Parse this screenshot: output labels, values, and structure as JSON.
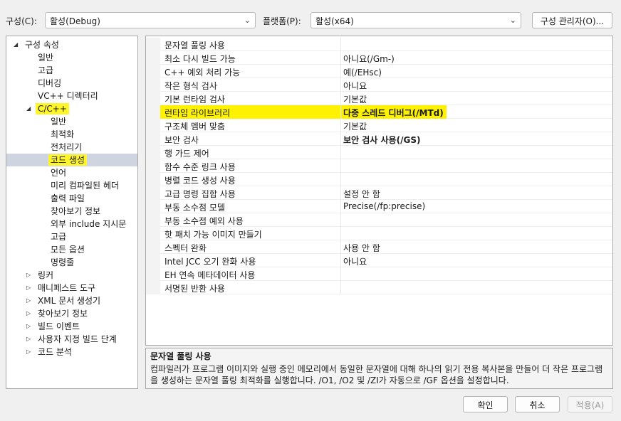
{
  "toolbar": {
    "config_label": "구성(C):",
    "config_value": "활성(Debug)",
    "platform_label": "플랫폼(P):",
    "platform_value": "활성(x64)",
    "manager_button": "구성 관리자(O)..."
  },
  "tree": {
    "items": [
      {
        "label": "구성 속성",
        "expanded": true
      },
      {
        "label": "일반"
      },
      {
        "label": "고급"
      },
      {
        "label": "디버깅"
      },
      {
        "label": "VC++ 디렉터리"
      },
      {
        "label": "C/C++",
        "expanded": true,
        "highlighted": true
      },
      {
        "label": "일반"
      },
      {
        "label": "최적화"
      },
      {
        "label": "전처리기"
      },
      {
        "label": "코드 생성",
        "selected": true,
        "highlighted": true
      },
      {
        "label": "언어"
      },
      {
        "label": "미리 컴파일된 헤더"
      },
      {
        "label": "출력 파일"
      },
      {
        "label": "찾아보기 정보"
      },
      {
        "label": "외부 include 지시문"
      },
      {
        "label": "고급"
      },
      {
        "label": "모든 옵션"
      },
      {
        "label": "명령줄"
      },
      {
        "label": "링커",
        "expanded": false
      },
      {
        "label": "매니페스트 도구",
        "expanded": false
      },
      {
        "label": "XML 문서 생성기",
        "expanded": false
      },
      {
        "label": "찾아보기 정보",
        "expanded": false
      },
      {
        "label": "빌드 이벤트",
        "expanded": false
      },
      {
        "label": "사용자 지정 빌드 단계",
        "expanded": false
      },
      {
        "label": "코드 분석",
        "expanded": false
      }
    ]
  },
  "grid": {
    "rows": [
      {
        "name": "문자열 풀링 사용",
        "value": ""
      },
      {
        "name": "최소 다시 빌드 가능",
        "value": "아니요(/Gm-)"
      },
      {
        "name": "C++ 예외 처리 가능",
        "value": "예(/EHsc)"
      },
      {
        "name": "작은 형식 검사",
        "value": "아니요"
      },
      {
        "name": "기본 런타임 검사",
        "value": "기본값"
      },
      {
        "name": "런타임 라이브러리",
        "value": "다중 스레드 디버그(/MTd)",
        "bold": true,
        "highlighted": true
      },
      {
        "name": "구조체 멤버 맞춤",
        "value": "기본값"
      },
      {
        "name": "보안 검사",
        "value": "보안 검사 사용(/GS)",
        "bold": true
      },
      {
        "name": "행 가드 제어",
        "value": ""
      },
      {
        "name": "함수 수준 링크 사용",
        "value": ""
      },
      {
        "name": "병렬 코드 생성 사용",
        "value": ""
      },
      {
        "name": "고급 명령 집합 사용",
        "value": "설정 안 함"
      },
      {
        "name": "부동 소수점 모델",
        "value": "Precise(/fp:precise)"
      },
      {
        "name": "부동 소수점 예외 사용",
        "value": ""
      },
      {
        "name": "핫 패치 가능 이미지 만들기",
        "value": ""
      },
      {
        "name": "스펙터 완화",
        "value": "사용 안 함"
      },
      {
        "name": "Intel JCC 오기 완화 사용",
        "value": "아니요"
      },
      {
        "name": "EH 연속 메타데이터 사용",
        "value": ""
      },
      {
        "name": "서명된 반환 사용",
        "value": ""
      }
    ]
  },
  "description": {
    "title": "문자열 풀링 사용",
    "text": "컴파일러가 프로그램 이미지와 실행 중인 메모리에서 동일한 문자열에 대해 하나의 읽기 전용 복사본을 만들어 더 작은 프로그램을 생성하는 문자열 풀링 최적화를 실행합니다. /O1, /O2 및 /ZI가 자동으로 /GF 옵션을 설정합니다."
  },
  "buttons": {
    "ok": "확인",
    "cancel": "취소",
    "apply": "적용(A)"
  },
  "colors": {
    "highlight": "#fff200",
    "selection": "#cfd5e0"
  },
  "icons": {
    "expanded": "triangle-down-icon",
    "collapsed": "triangle-right-icon",
    "dropdown": "chevron-down-icon"
  }
}
